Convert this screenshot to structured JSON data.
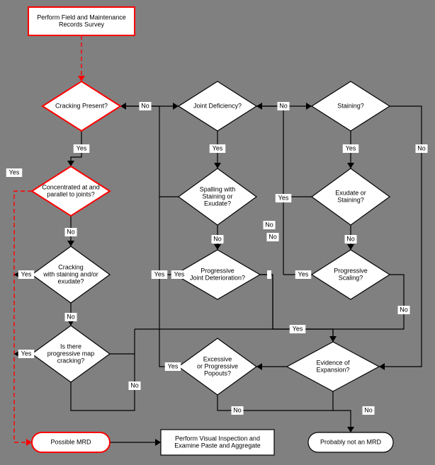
{
  "chart_data": {
    "type": "flowchart",
    "title": "",
    "nodes": [
      {
        "id": "start",
        "kind": "process",
        "highlight": true,
        "label": [
          "Perform Field and Maintenance",
          "Records Survey"
        ]
      },
      {
        "id": "crackingPresent",
        "kind": "decision",
        "highlight": true,
        "label": [
          "Cracking Present?"
        ]
      },
      {
        "id": "jointDeficiency",
        "kind": "decision",
        "highlight": false,
        "label": [
          "Joint Deficiency?"
        ]
      },
      {
        "id": "staining",
        "kind": "decision",
        "highlight": false,
        "label": [
          "Staining?"
        ]
      },
      {
        "id": "concentrated",
        "kind": "decision",
        "highlight": true,
        "label": [
          "Concentrated at and",
          "parallel to joints?"
        ]
      },
      {
        "id": "spallingWith",
        "kind": "decision",
        "highlight": false,
        "label": [
          "Spalling with",
          "Staining or",
          "Exudate?"
        ]
      },
      {
        "id": "exudateOrStaining",
        "kind": "decision",
        "highlight": false,
        "label": [
          "Exudate or",
          "Staining?"
        ]
      },
      {
        "id": "crackingWithStaining",
        "kind": "decision",
        "highlight": false,
        "label": [
          "Cracking",
          "with staining and/or",
          "exudate?"
        ]
      },
      {
        "id": "progressiveJoint",
        "kind": "decision",
        "highlight": false,
        "label": [
          "Progressive",
          "Joint Deterioration?"
        ]
      },
      {
        "id": "progressiveScaling",
        "kind": "decision",
        "highlight": false,
        "label": [
          "Progressive",
          "Scaling?"
        ]
      },
      {
        "id": "isThereMap",
        "kind": "decision",
        "highlight": false,
        "label": [
          "Is there",
          "progressive map",
          "cracking?"
        ]
      },
      {
        "id": "excessivePopouts",
        "kind": "decision",
        "highlight": false,
        "label": [
          "Excessive",
          "or Progressive",
          "Popouts?"
        ]
      },
      {
        "id": "evidenceExpansion",
        "kind": "decision",
        "highlight": false,
        "label": [
          "Evidence of",
          "Expansion?"
        ]
      },
      {
        "id": "possibleMRD",
        "kind": "terminator",
        "highlight": true,
        "label": [
          "Possible MRD"
        ]
      },
      {
        "id": "performVisual",
        "kind": "process",
        "highlight": false,
        "label": [
          "Perform Visual Inspection and",
          "Examine Paste and Aggregate"
        ]
      },
      {
        "id": "probablyNot",
        "kind": "terminator",
        "highlight": false,
        "label": [
          "Probably not an MRD"
        ]
      }
    ],
    "edges": [
      {
        "from": "start",
        "to": "crackingPresent",
        "label": "",
        "style": "red-dashed"
      },
      {
        "from": "crackingPresent",
        "to": "concentrated",
        "label": "Yes",
        "style": "black"
      },
      {
        "from": "crackingPresent",
        "to": "jointDeficiency",
        "label": "No",
        "style": "black"
      },
      {
        "from": "jointDeficiency",
        "to": "spallingWith",
        "label": "Yes",
        "style": "black"
      },
      {
        "from": "jointDeficiency",
        "to": "staining",
        "label": "No",
        "style": "black"
      },
      {
        "from": "staining",
        "to": "exudateOrStaining",
        "label": "Yes",
        "style": "black"
      },
      {
        "from": "staining",
        "to": "evidenceExpansion",
        "label": "No",
        "style": "black"
      },
      {
        "from": "concentrated",
        "to": "possibleMRD",
        "label": "Yes",
        "style": "red-dashed"
      },
      {
        "from": "concentrated",
        "to": "crackingWithStaining",
        "label": "No",
        "style": "black"
      },
      {
        "from": "spallingWith",
        "to": "crackingPresent",
        "label": "Yes",
        "style": "black"
      },
      {
        "from": "spallingWith",
        "to": "progressiveJoint",
        "label": "No",
        "style": "black"
      },
      {
        "from": "exudateOrStaining",
        "to": "jointDeficiency",
        "label": "Yes",
        "style": "black"
      },
      {
        "from": "exudateOrStaining",
        "to": "progressiveScaling",
        "label": "No",
        "style": "black"
      },
      {
        "from": "crackingWithStaining",
        "to": "possibleMRD",
        "label": "Yes",
        "style": "black"
      },
      {
        "from": "crackingWithStaining",
        "to": "isThereMap",
        "label": "No",
        "style": "black"
      },
      {
        "from": "progressiveJoint",
        "to": "possibleMRD",
        "label": "Yes",
        "style": "black"
      },
      {
        "from": "progressiveJoint",
        "to": "evidenceExpansion",
        "label": "No",
        "style": "black"
      },
      {
        "from": "progressiveScaling",
        "to": "possibleMRD",
        "label": "Yes",
        "style": "black"
      },
      {
        "from": "progressiveScaling",
        "to": "evidenceExpansion",
        "label": "No",
        "style": "black"
      },
      {
        "from": "isThereMap",
        "to": "possibleMRD",
        "label": "Yes",
        "style": "black",
        "alsoTo": "performVisual"
      },
      {
        "from": "isThereMap",
        "to": "evidenceExpansion",
        "label": "No",
        "style": "black"
      },
      {
        "from": "evidenceExpansion",
        "to": "excessivePopouts",
        "label": "Yes",
        "style": "black"
      },
      {
        "from": "evidenceExpansion",
        "to": "probablyNot",
        "label": "No",
        "style": "black"
      },
      {
        "from": "excessivePopouts",
        "to": "possibleMRD",
        "label": "Yes",
        "style": "black"
      },
      {
        "from": "excessivePopouts",
        "to": "probablyNot",
        "label": "No",
        "style": "black"
      },
      {
        "from": "possibleMRD",
        "to": "performVisual",
        "label": "",
        "style": "black"
      }
    ]
  },
  "labels": {
    "yes": "Yes",
    "no": "No"
  }
}
